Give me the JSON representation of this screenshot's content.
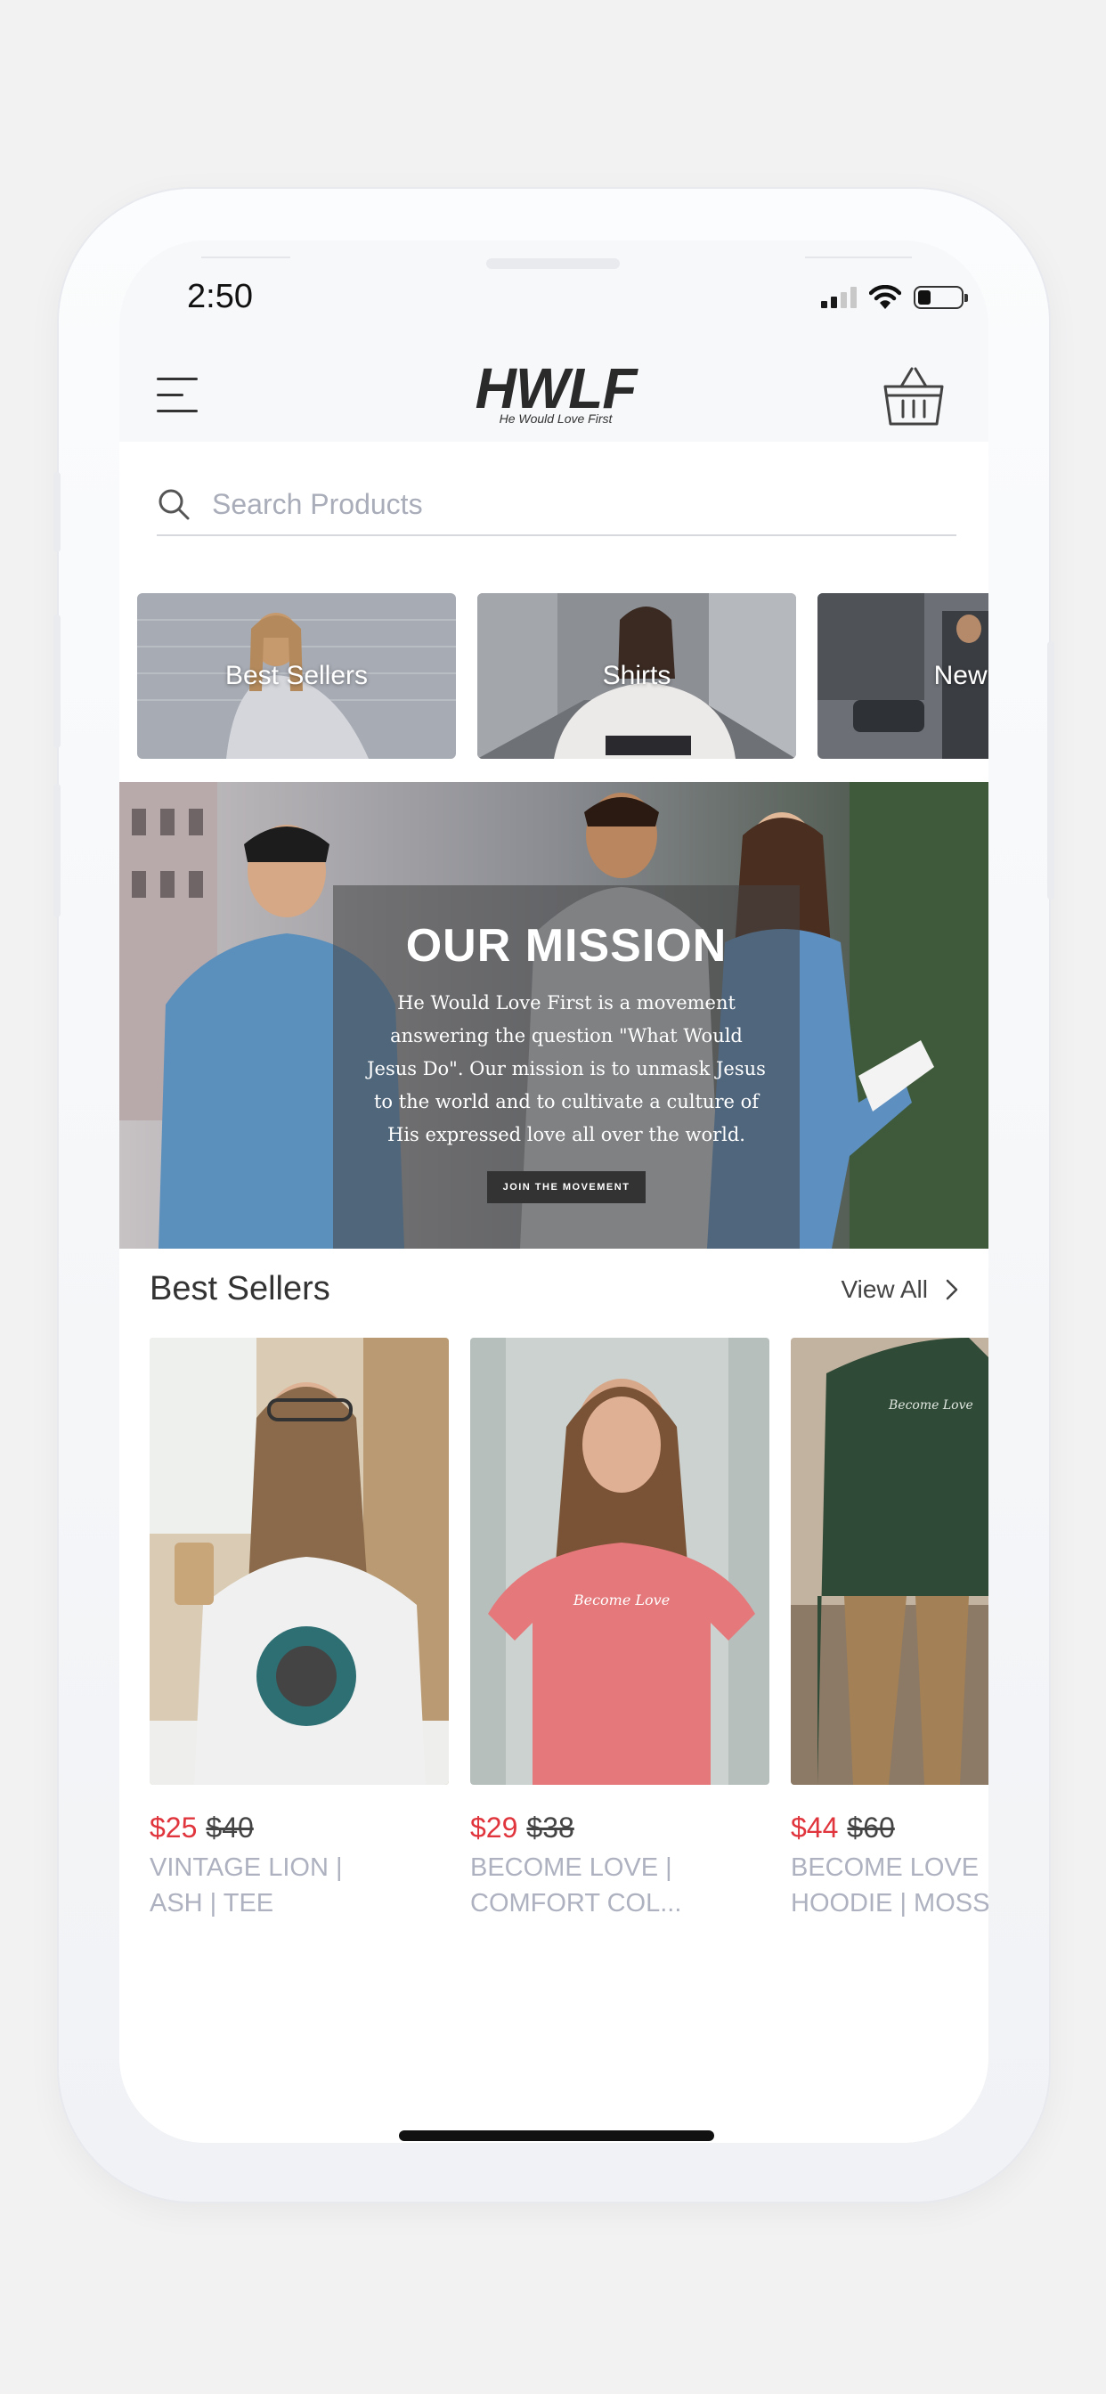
{
  "status_bar": {
    "time": "2:50"
  },
  "header": {
    "logo_main": "HWLF",
    "logo_sub": "He Would Love First"
  },
  "search": {
    "placeholder": "Search Products"
  },
  "categories": [
    {
      "label": "Best Sellers"
    },
    {
      "label": "Shirts"
    },
    {
      "label": "New Ar"
    }
  ],
  "mission": {
    "title": "OUR MISSION",
    "text": "He Would Love First is a movement answering the question \"What Would Jesus Do\". Our mission is to unmask Jesus to the world and to cultivate a culture of His expressed love all over the world.",
    "button": "JOIN THE MOVEMENT"
  },
  "best_sellers": {
    "title": "Best Sellers",
    "view_all": "View All",
    "products": [
      {
        "price": "$25",
        "old_price": "$40",
        "name": "VINTAGE LION |\nASH | TEE"
      },
      {
        "price": "$29",
        "old_price": "$38",
        "name": "BECOME LOVE |\nCOMFORT COL..."
      },
      {
        "price": "$44",
        "old_price": "$60",
        "name": "BECOME LOVE\nHOODIE | MOSS"
      }
    ]
  },
  "colors": {
    "sale_price": "#e0353d",
    "product_name": "#aeb2c0"
  },
  "icons": [
    "menu-icon",
    "basket-icon",
    "search-icon",
    "chevron-right-icon",
    "wifi-icon",
    "signal-icon",
    "battery-icon"
  ]
}
